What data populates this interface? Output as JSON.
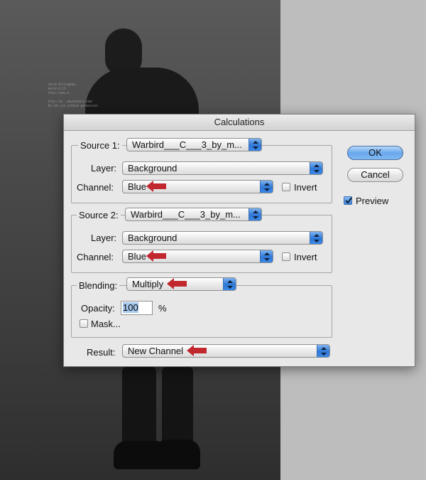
{
  "background": {
    "watermark_text": "Sarah Willoughby\nWarbird C3\nhttp://www.m...\n\nhttp://m...deviantart.com/\nDo not use without permission"
  },
  "dialog": {
    "title": "Calculations",
    "source1": {
      "label": "Source 1:",
      "file": "Warbird___C___3_by_m...",
      "layer_label": "Layer:",
      "layer": "Background",
      "channel_label": "Channel:",
      "channel": "Blue",
      "invert_label": "Invert",
      "invert_checked": false
    },
    "source2": {
      "label": "Source 2:",
      "file": "Warbird___C___3_by_m...",
      "layer_label": "Layer:",
      "layer": "Background",
      "channel_label": "Channel:",
      "channel": "Blue",
      "invert_label": "Invert",
      "invert_checked": false
    },
    "blending": {
      "label": "Blending:",
      "mode": "Multiply",
      "opacity_label": "Opacity:",
      "opacity": "100",
      "opacity_unit": "%",
      "mask_label": "Mask...",
      "mask_checked": false
    },
    "result": {
      "label": "Result:",
      "value": "New Channel"
    },
    "buttons": {
      "ok": "OK",
      "cancel": "Cancel"
    },
    "preview": {
      "label": "Preview",
      "checked": true
    }
  },
  "colors": {
    "annotation_arrow": "#c0282e",
    "dialog_bg": "#e8e8e8",
    "accent_blue": "#3b82dc"
  }
}
